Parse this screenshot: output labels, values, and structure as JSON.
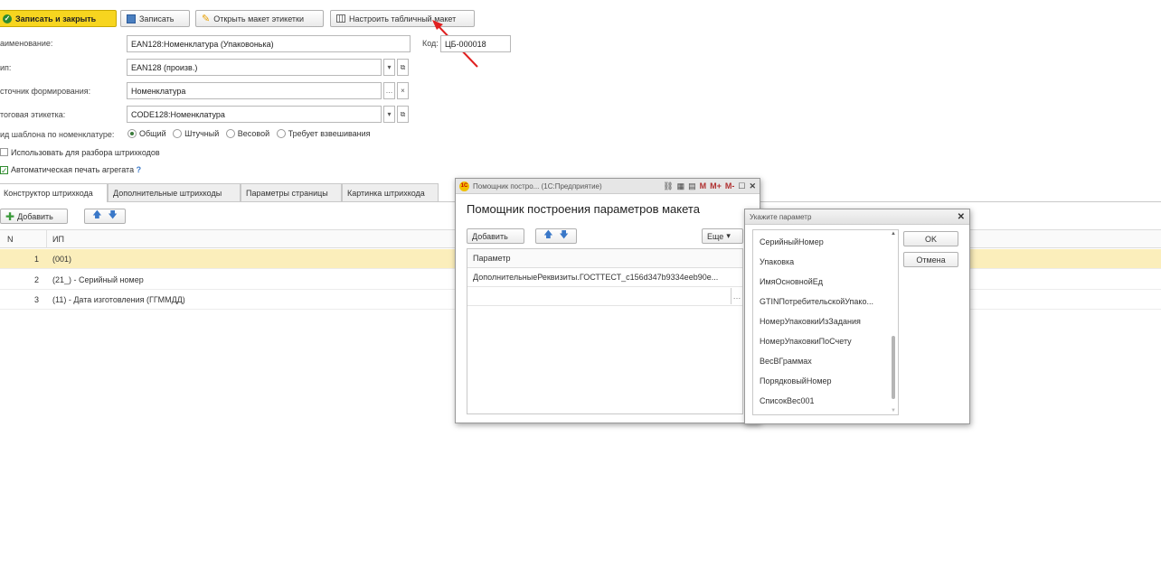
{
  "toolbar": {
    "save_close": "Записать и закрыть",
    "save": "Записать",
    "open_label_layout": "Открыть макет этикетки",
    "configure_table_layout": "Настроить табличный макет"
  },
  "form": {
    "name_label": "аименование:",
    "name_value": "EAN128:Номенклатура (Упаковонька)",
    "code_label": "Код:",
    "code_value": "ЦБ-000018",
    "type_label": "ип:",
    "type_value": "EAN128 (произв.)",
    "source_label": "сточник формирования:",
    "source_value": "Номенклатура",
    "final_label_label": "тоговая этикетка:",
    "final_label_value": "CODE128:Номенклатура",
    "template_kind_label": "ид шаблона по номенклатуре:",
    "template_kinds": [
      "Общий",
      "Штучный",
      "Весовой",
      "Требует взвешивания"
    ],
    "template_kind_selected": "Общий",
    "use_for_barcode_parsing": "Использовать для разбора штрихкодов",
    "auto_print_aggregate": "Автоматическая печать агрегата",
    "help_mark": "?"
  },
  "tabs": [
    "Конструктор штрихкода",
    "Дополнительные штрихкоды",
    "Параметры страницы",
    "Картинка штрихкода"
  ],
  "table_toolbar": {
    "add": "Добавить"
  },
  "table": {
    "headers": [
      "N",
      "ИП"
    ],
    "rows": [
      {
        "n": "1",
        "ip": "(001)"
      },
      {
        "n": "2",
        "ip": "(21_) - Серийный номер"
      },
      {
        "n": "3",
        "ip": "(11) - Дата изготовления (ГГММДД)"
      }
    ]
  },
  "assistant_dialog": {
    "window_title": "Помощник постро... (1С:Предприятие)",
    "title_icons": [
      "M",
      "M+",
      "M-"
    ],
    "heading": "Помощник построения параметров макета",
    "add": "Добавить",
    "more": "Еще",
    "column_header": "Параметр",
    "rows": [
      "ДополнительныеРеквизиты.ГОСТТЕСТ_c156d347b9334eeb90e..."
    ]
  },
  "param_dialog": {
    "title": "Укажите параметр",
    "ok": "OK",
    "cancel": "Отмена",
    "items": [
      "СерийныйНомер",
      "Упаковка",
      "ИмяОсновнойЕд",
      "GTINПотребительскойУпако...",
      "НомерУпаковкиИзЗадания",
      "НомерУпаковкиПоСчету",
      "ВесВГраммах",
      "ПорядковыйНомер",
      "СписокВес001"
    ]
  },
  "colors": {
    "primary_button": "#f7d51f",
    "selected_row": "#fbeebb",
    "annotation_arrow": "#e02020",
    "check_green": "#2e8b2e"
  }
}
